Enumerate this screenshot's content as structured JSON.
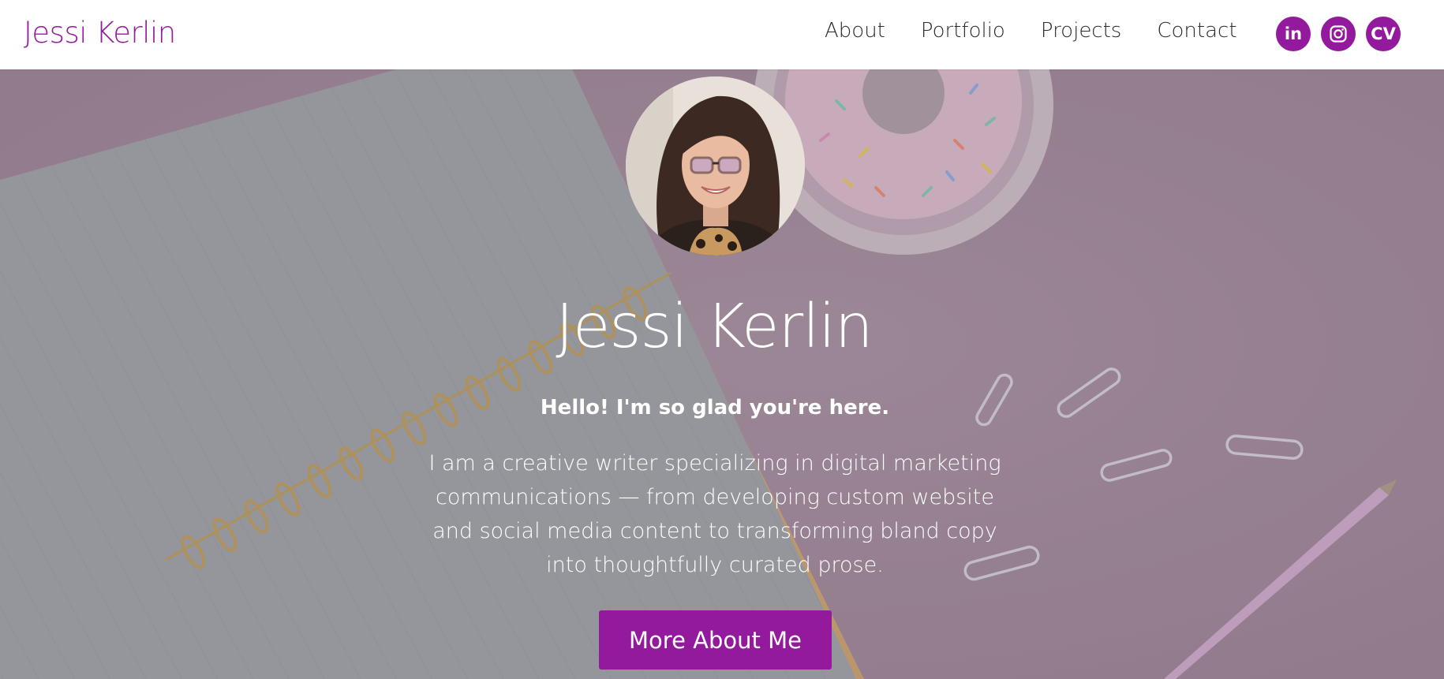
{
  "nav": {
    "brand": "Jessi Kerlin",
    "links": [
      "About",
      "Portfolio",
      "Projects",
      "Contact"
    ],
    "social": [
      {
        "icon": "linkedin-icon",
        "label": "in"
      },
      {
        "icon": "instagram-icon",
        "label": ""
      },
      {
        "icon": "cv-icon",
        "label": "CV"
      }
    ]
  },
  "hero": {
    "title": "Jessi Kerlin",
    "greeting": "Hello! I'm so glad you're here.",
    "body": "I am a creative writer specializing in digital marketing communications — from developing custom website and social media content to transforming bland copy into thoughtfully curated prose.",
    "cta_label": "More About Me"
  },
  "colors": {
    "accent": "#93199d",
    "nav_text": "#2b2b2b",
    "hero_text": "#ffffff"
  }
}
